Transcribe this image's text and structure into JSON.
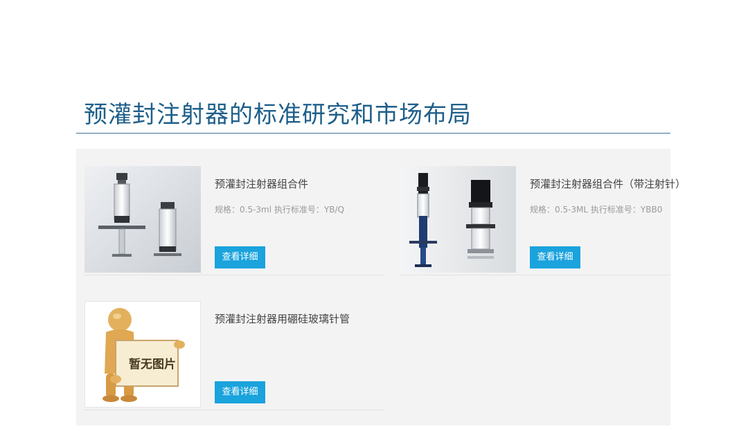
{
  "page": {
    "title": "预灌封注射器的标准研究和市场布局",
    "accent_color": "#1e5f8a",
    "button_color": "#1aa3dd"
  },
  "products": [
    {
      "name": "预灌封注射器组合件",
      "spec": "规格：0.5-3ml 执行标准号：YB/Q",
      "button_label": "查看详细",
      "image_icon": "glass-syringe-image"
    },
    {
      "name": "预灌封注射器组合件（带注射针）",
      "spec": "规格：0.5-3ML 执行标准号：YBB0",
      "button_label": "查看详细",
      "image_icon": "syringe-with-needle-image"
    },
    {
      "name": "预灌封注射器用硼硅玻璃针管",
      "spec": "",
      "button_label": "查看详细",
      "image_icon": "no-image-placeholder",
      "placeholder_text": "暂无图片"
    }
  ]
}
